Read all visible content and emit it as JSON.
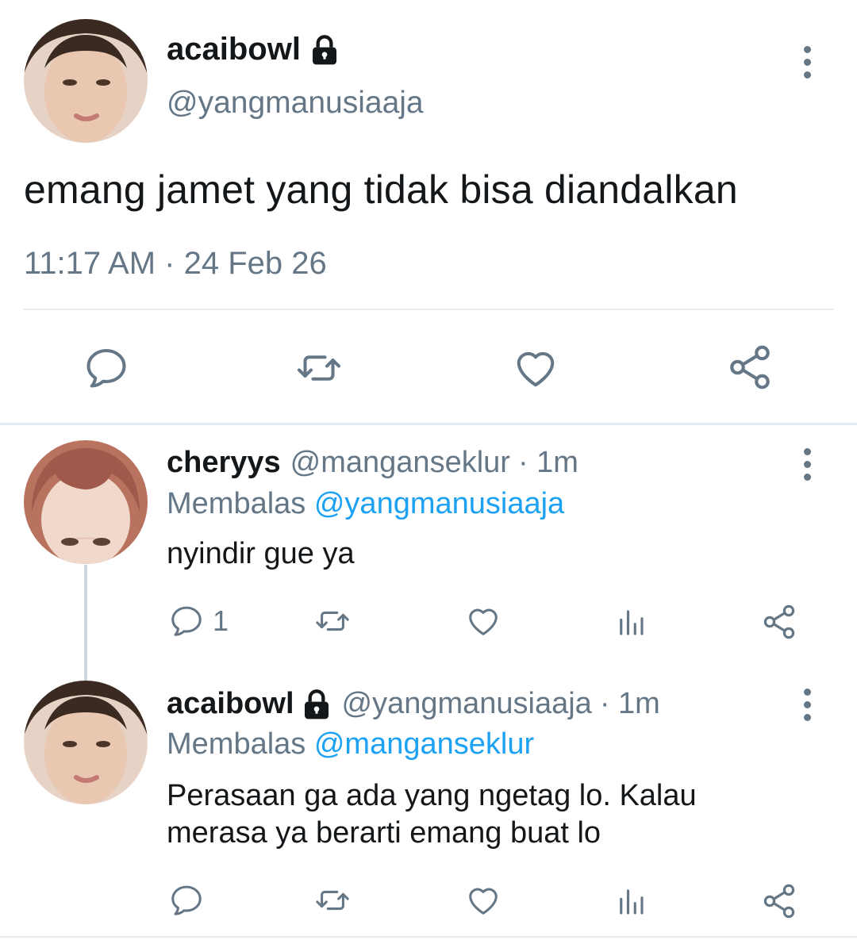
{
  "main_tweet": {
    "name": "acaibowl",
    "handle": "@yangmanusiaaja",
    "text": "emang jamet yang tidak bisa diandalkan",
    "time": "11:17 AM",
    "separator": "·",
    "date": "24 Feb 26",
    "icons": {
      "locked": "lock-icon",
      "more": "more-vertical-icon",
      "reply": "reply-icon",
      "retweet": "retweet-icon",
      "like": "heart-icon",
      "share": "share-icon"
    }
  },
  "replies": [
    {
      "name": "cheryys",
      "handle": "@manganseklur",
      "time": "· 1m",
      "replying_prefix": "Membalas",
      "replying_to": "@yangmanusiaaja",
      "text": "nyindir gue ya",
      "reply_count": "1",
      "locked": false
    },
    {
      "name": "acaibowl",
      "handle": "@yangmanusiaaja",
      "time": "· 1m",
      "replying_prefix": "Membalas",
      "replying_to": "@manganseklur",
      "text_line1": "Perasaan ga ada yang ngetag lo. Kalau",
      "text_line2": "merasa ya berarti emang buat lo",
      "reply_count": "",
      "locked": true
    }
  ],
  "colors": {
    "text": "#14171a",
    "secondary": "#657786",
    "link": "#1da1f2",
    "divider": "#e6ecf0"
  }
}
